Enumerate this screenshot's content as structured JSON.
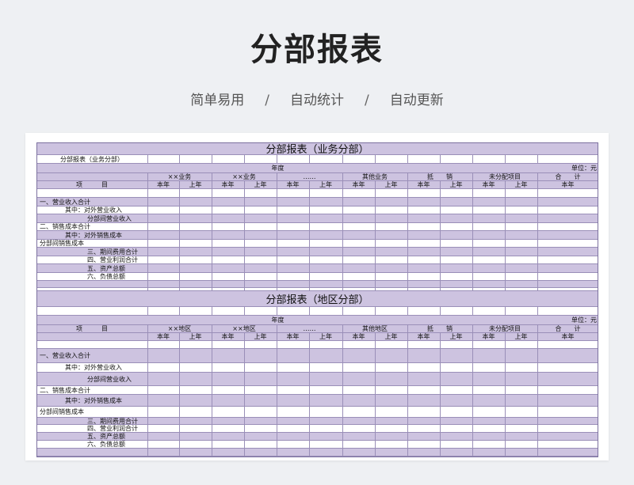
{
  "header": {
    "title": "分部报表",
    "tags": [
      "简单易用",
      "自动统计",
      "自动更新"
    ],
    "separator": "/"
  },
  "table1": {
    "title": "分部报表（业务分部）",
    "subtitle": "分部报表（业务分部）",
    "year_label": "年度",
    "unit_label": "单位：元",
    "groups": [
      "××业务",
      "××业务",
      "……",
      "其他业务",
      "抵　　销",
      "未分配项目",
      "合　　计"
    ],
    "sub_cur": "本年",
    "sub_prev": "上年",
    "item_header": "项　　　目",
    "items": [
      "一、营业收入合计",
      "其中：对外营业收入",
      "分部间营业收入",
      "二、销售成本合计",
      "其中：对外销售成本",
      "分部间销售成本",
      "三、期间费用合计",
      "四、营业利润合计",
      "五、资产总额",
      "六、负债总额"
    ]
  },
  "table2": {
    "title": "分部报表（地区分部）",
    "year_label": "年度",
    "unit_label": "单位：元",
    "groups": [
      "××地区",
      "××地区",
      "……",
      "其他地区",
      "抵　　销",
      "未分配项目",
      "合　　计"
    ],
    "sub_cur": "本年",
    "sub_prev": "上年",
    "item_header": "项　　　目",
    "items": [
      "一、营业收入合计",
      "其中：对外营业收入",
      "分部间营业收入",
      "二、销售成本合计",
      "其中：对外销售成本",
      "分部间销售成本",
      "三、期间费用合计",
      "四、营业利润合计",
      "五、资产总额",
      "六、负债总额"
    ]
  }
}
